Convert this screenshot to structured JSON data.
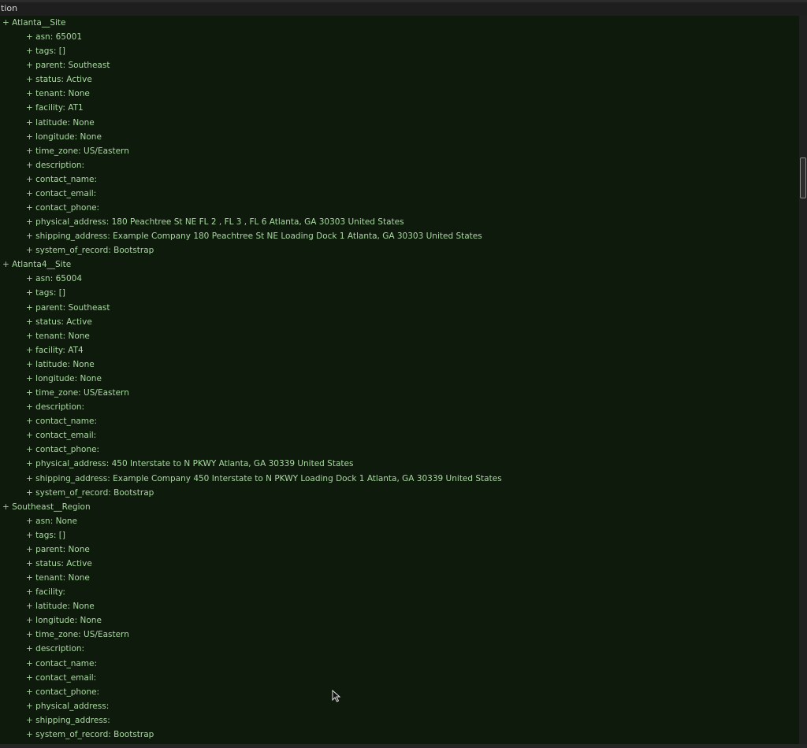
{
  "tab": {
    "title": "tion"
  },
  "nodes": [
    {
      "name": "Atlanta__Site",
      "children": [
        "asn: 65001",
        "tags: []",
        "parent: Southeast",
        "status: Active",
        "tenant: None",
        "facility: AT1",
        "latitude: None",
        "longitude: None",
        "time_zone: US/Eastern",
        "description:",
        "contact_name:",
        "contact_email:",
        "contact_phone:",
        "physical_address: 180 Peachtree St NE FL 2 , FL 3 , FL 6 Atlanta, GA 30303 United States",
        "shipping_address: Example Company 180 Peachtree St NE Loading Dock 1 Atlanta, GA 30303 United States",
        "system_of_record: Bootstrap"
      ]
    },
    {
      "name": "Atlanta4__Site",
      "children": [
        "asn: 65004",
        "tags: []",
        "parent: Southeast",
        "status: Active",
        "tenant: None",
        "facility: AT4",
        "latitude: None",
        "longitude: None",
        "time_zone: US/Eastern",
        "description:",
        "contact_name:",
        "contact_email:",
        "contact_phone:",
        "physical_address: 450 Interstate to N PKWY Atlanta, GA 30339 United States",
        "shipping_address: Example Company 450 Interstate to N PKWY Loading Dock 1 Atlanta, GA 30339 United States",
        "system_of_record: Bootstrap"
      ]
    },
    {
      "name": "Southeast__Region",
      "children": [
        "asn: None",
        "tags: []",
        "parent: None",
        "status: Active",
        "tenant: None",
        "facility:",
        "latitude: None",
        "longitude: None",
        "time_zone: US/Eastern",
        "description:",
        "contact_name:",
        "contact_email:",
        "contact_phone:",
        "physical_address:",
        "shipping_address:",
        "system_of_record: Bootstrap"
      ]
    }
  ],
  "expander_symbol": "+",
  "colors": {
    "background": "#0e1a0b",
    "text": "#9fcf98",
    "chrome": "#1e1e1e"
  },
  "icons": {
    "expander": "plus-icon",
    "cursor": "mouse-pointer-icon"
  }
}
